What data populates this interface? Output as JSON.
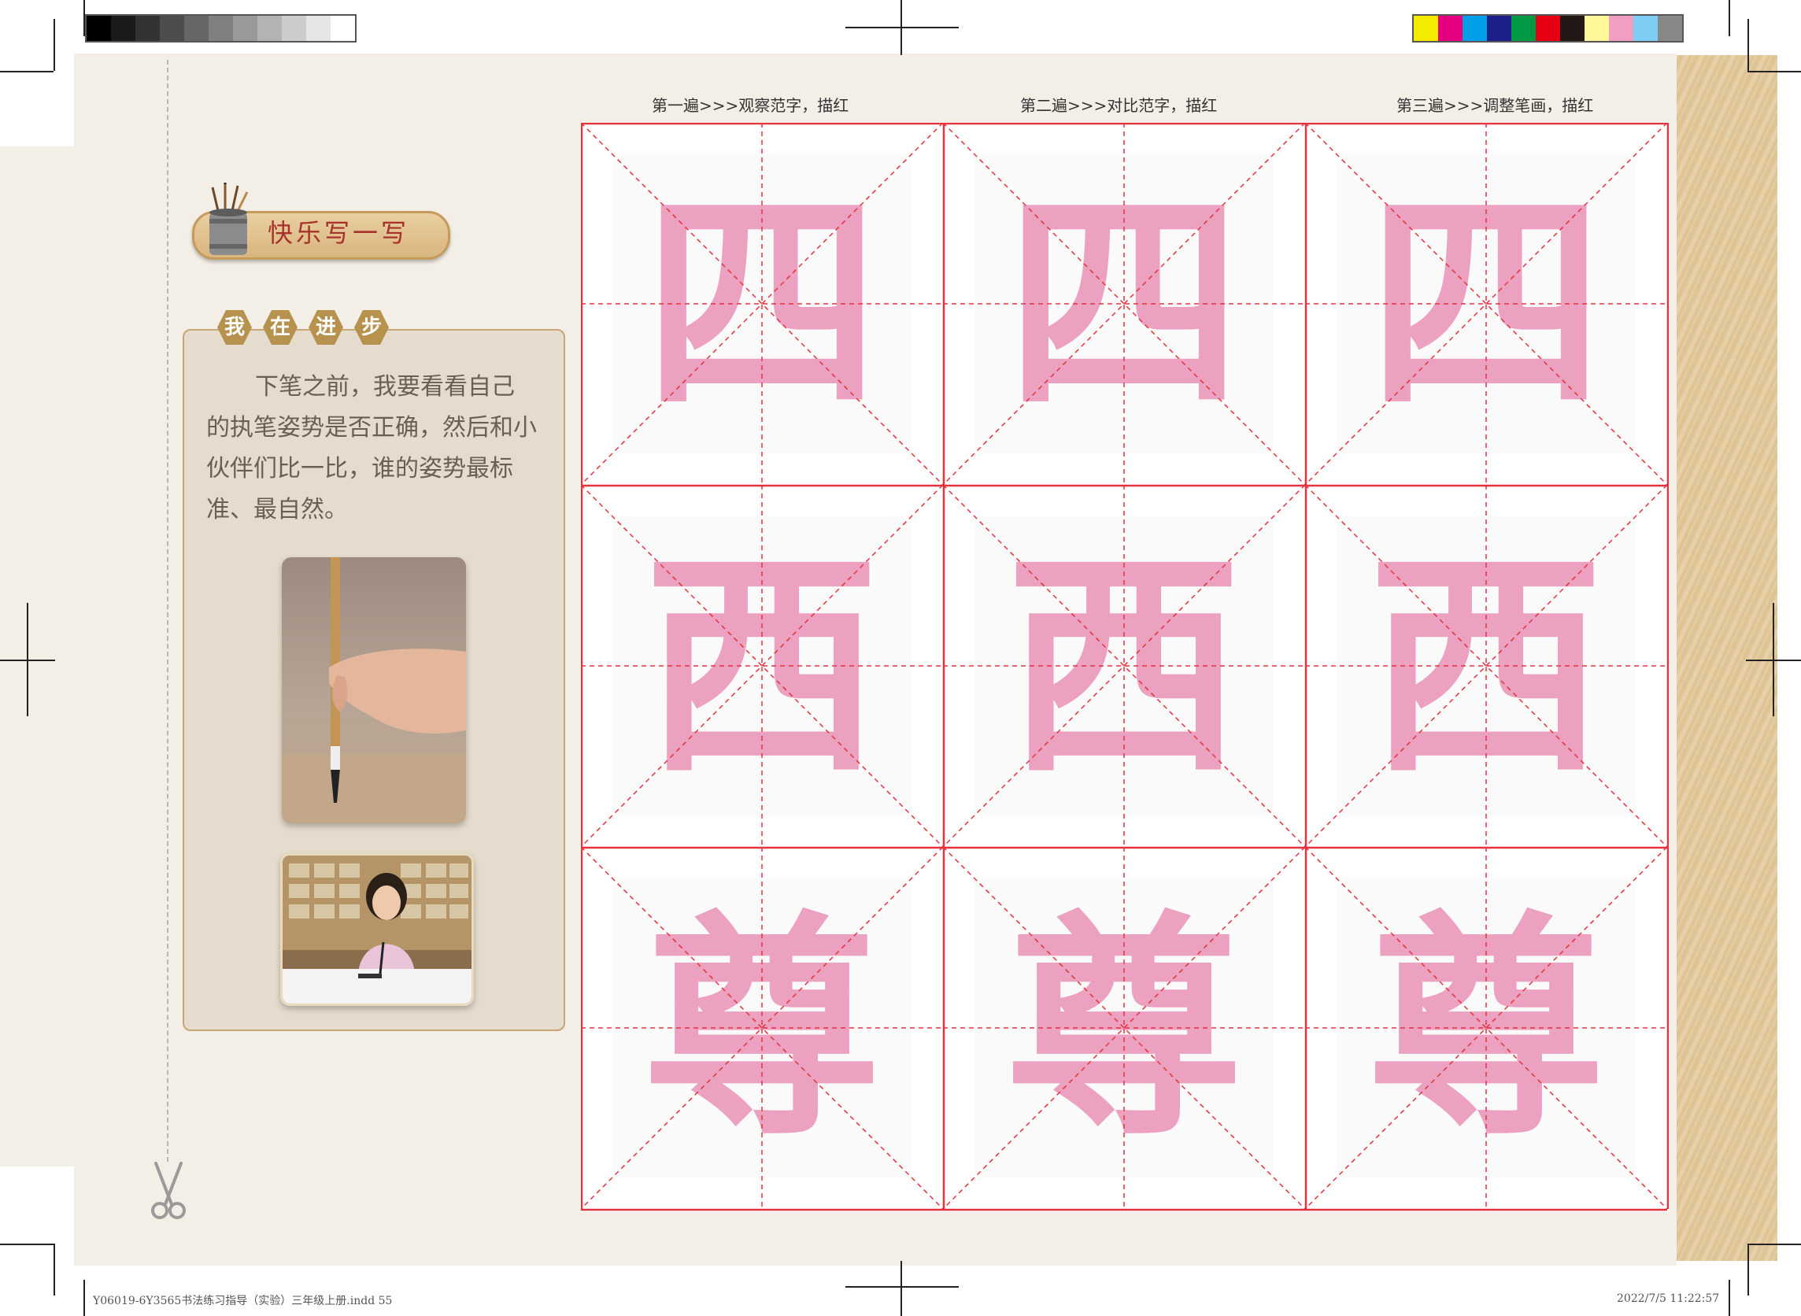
{
  "color_bar": {
    "grays": [
      "#000000",
      "#1a1a1a",
      "#333333",
      "#4d4d4d",
      "#666666",
      "#808080",
      "#999999",
      "#b3b3b3",
      "#cccccc",
      "#e6e6e6",
      "#ffffff"
    ],
    "colors": [
      "#f5ec00",
      "#e4007f",
      "#00a0e9",
      "#1d2088",
      "#009944",
      "#e60012",
      "#231815",
      "#fff799",
      "#f19ec2",
      "#7ecef4",
      "#888888"
    ]
  },
  "section_title": "快乐写一写",
  "progress": {
    "heading_chars": [
      "我",
      "在",
      "进",
      "步"
    ],
    "body": "下笔之前，我要看看自己的执笔姿势是否正确，然后和小伙伴们比一比，谁的姿势最标准、最自然。"
  },
  "practice_grid": {
    "columns": [
      "第一遍>>>观察范字，描红",
      "第二遍>>>对比范字，描红",
      "第三遍>>>调整笔画，描红"
    ],
    "rows": [
      [
        "四",
        "四",
        "四"
      ],
      [
        "西",
        "西",
        "西"
      ],
      [
        "尊",
        "尊",
        "尊"
      ]
    ],
    "char_color": "#eba1bf",
    "line_color": "#e5323e"
  },
  "footer": {
    "file_info": "Y06019-6Y3565书法练习指导（实验）三年级上册.indd   55",
    "timestamp": "2022/7/5   11:22:57"
  }
}
